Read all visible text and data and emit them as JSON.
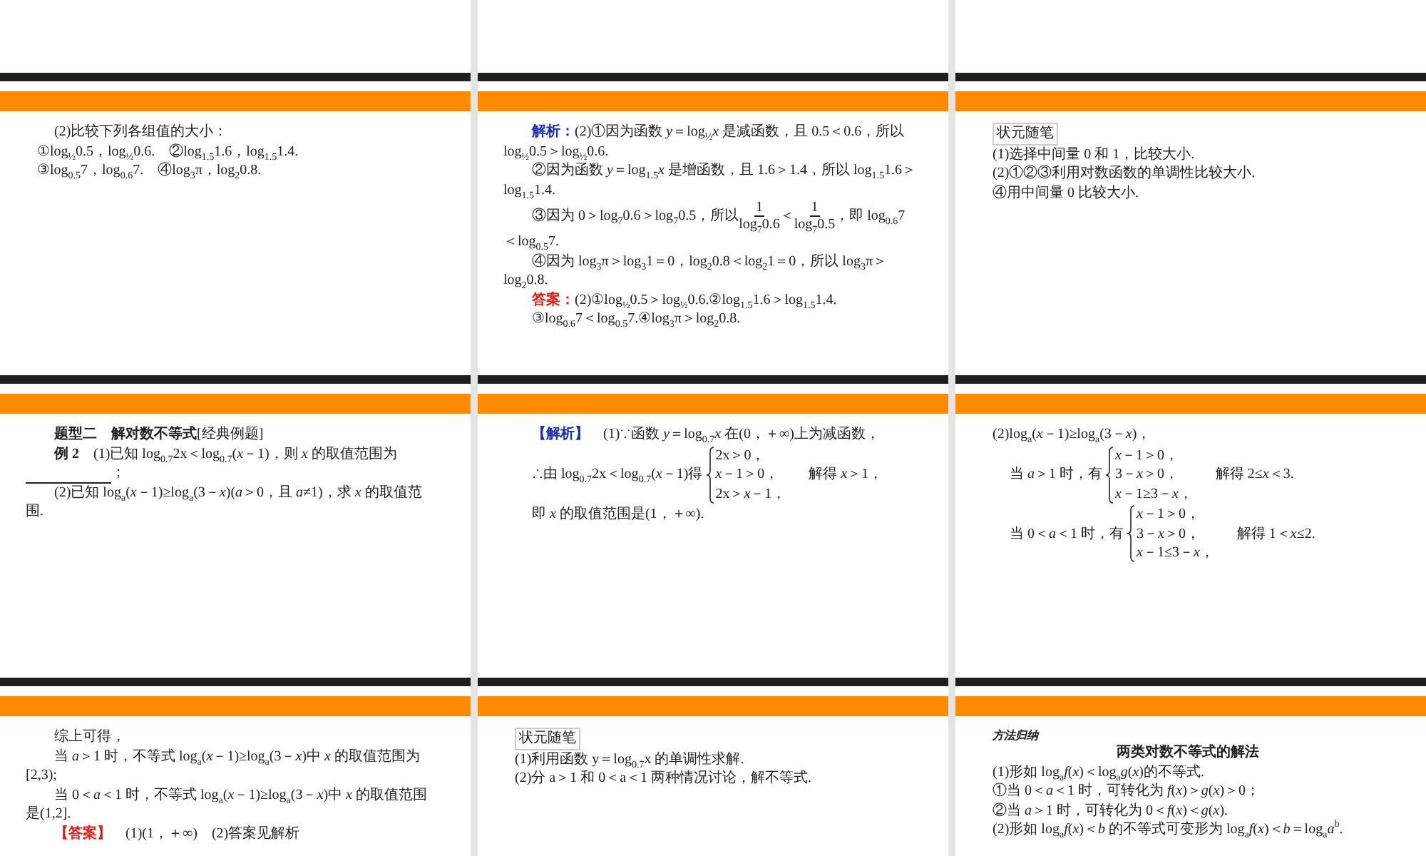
{
  "slides": [
    {
      "blocks": [
        {
          "kind": "para",
          "text": "(2)比较下列各组值的大小："
        },
        {
          "kind": "line",
          "text": "①log$_{½}$0.5，log$_{½}$0.6.　②log$_{1.5}$1.6，log$_{1.5}$1.4."
        },
        {
          "kind": "line",
          "text": "③log$_{0.5}$7，log$_{0.6}$7.　④log$_{3}$π，log$_{2}$0.8."
        }
      ]
    },
    {
      "blocks": [
        {
          "kind": "para",
          "lead": {
            "text": "解析：",
            "kind": "analysis"
          },
          "text": "(2)①因为函数 *y*＝log$_{½}$*x* 是减函数，且 0.5＜0.6，所以 log$_{½}$0.5＞log$_{½}$0.6."
        },
        {
          "kind": "para",
          "text": "②因为函数 *y*＝log$_{1.5}$*x* 是增函数，且 1.6＞1.4，所以 log$_{1.5}$1.6＞log$_{1.5}$1.4."
        },
        {
          "kind": "fraction_para",
          "parts": [
            {
              "text": "③因为 0＞log$_{7}$0.6＞log$_{7}$0.5，所以"
            },
            {
              "num": "1",
              "den": "log$_{7}$0.6"
            },
            {
              "text": "＜"
            },
            {
              "num": "1",
              "den": "log$_{7}$0.5"
            },
            {
              "text": "，即 log$_{0.6}$7＜log$_{0.5}$7."
            }
          ]
        },
        {
          "kind": "para",
          "text": "④因为 log$_{3}$π＞log$_{3}$1＝0，log$_{2}$0.8＜log$_{2}$1＝0，所以 log$_{3}$π＞log$_{2}$0.8."
        },
        {
          "kind": "para",
          "lead": {
            "text": "答案：",
            "kind": "answer"
          },
          "text": "(2)①log$_{½}$0.5＞log$_{½}$0.6.②log$_{1.5}$1.6＞log$_{1.5}$1.4."
        },
        {
          "kind": "para",
          "text": "③log$_{0.6}$7＜log$_{0.5}$7.④log$_{3}$π＞log$_{2}$0.8."
        }
      ]
    },
    {
      "blocks": [
        {
          "kind": "label",
          "text": "状元随笔"
        },
        {
          "kind": "line",
          "text": "(1)选择中间量 0 和 1，比较大小."
        },
        {
          "kind": "line",
          "text": "(2)①②③利用对数函数的单调性比较大小."
        },
        {
          "kind": "line",
          "text": "④用中间量 0 比较大小."
        }
      ]
    },
    {
      "blocks": [
        {
          "kind": "para",
          "text": "**题型二　解对数不等式**[经典例题]"
        },
        {
          "kind": "para",
          "text": "**例 2**　(1)已知 log$_{0.7}$2x＜log$_{0.7}$(*x*－1)，则 *x* 的取值范围为"
        },
        {
          "kind": "blank",
          "text": "；"
        },
        {
          "kind": "para",
          "text": "(2)已知 log$_{a}$(*x*－1)≥log$_{a}$(3－*x*)(*a*＞0，且 *a*≠1)，求 *x* 的取值范围."
        }
      ]
    },
    {
      "blocks": [
        {
          "kind": "para",
          "lead": {
            "text": "【解析】",
            "kind": "analysis"
          },
          "text": "　(1)∵函数 *y*＝log$_{0.7}$*x* 在(0，＋∞)上为减函数，"
        },
        {
          "kind": "system",
          "lead": "∴由 log$_{0.7}$2x＜log$_{0.7}$(*x*－1)得",
          "rows": [
            "2x＞0，",
            "*x*－1＞0，",
            "2x＞*x*－1，"
          ],
          "tail": "解得 *x*＞1，"
        },
        {
          "kind": "para",
          "text": "即 *x* 的取值范围是(1，＋∞)."
        }
      ]
    },
    {
      "blocks": [
        {
          "kind": "line",
          "text": "(2)log$_{a}$(*x*－1)≥log$_{a}$(3－*x*)，"
        },
        {
          "kind": "system",
          "lead": "当 *a*＞1 时，有",
          "rows": [
            "*x*－1＞0，",
            "3－*x*＞0，",
            "*x*－1≥3－*x*，"
          ],
          "tail": "解得 2≤*x*＜3."
        },
        {
          "kind": "system",
          "lead": "当 0＜*a*＜1 时，有",
          "rows": [
            "*x*－1＞0，",
            "3－*x*＞0，",
            "*x*－1≤3－*x*，"
          ],
          "tail": "解得 1＜*x*≤2."
        }
      ]
    },
    {
      "blocks": [
        {
          "kind": "para",
          "text": "综上可得，"
        },
        {
          "kind": "para",
          "text": "当 *a*＞1 时，不等式 log$_{a}$(*x*－1)≥log$_{a}$(3－*x*)中 *x* 的取值范围为[2,3);"
        },
        {
          "kind": "para",
          "text": "当 0＜*a*＜1 时，不等式 log$_{a}$(*x*－1)≥log$_{a}$(3－*x*)中 *x* 的取值范围是(1,2]."
        },
        {
          "kind": "para",
          "lead": {
            "text": "【答案】",
            "kind": "answer"
          },
          "text": "　(1)(1，＋∞)　(2)答案见解析"
        }
      ]
    },
    {
      "blocks": [
        {
          "kind": "label",
          "text": "状元随笔"
        },
        {
          "kind": "line",
          "text": "(1)利用函数 y＝log$_{0.7}$x 的单调性求解."
        },
        {
          "kind": "line",
          "text": "(2)分 a＞1 和 0＜a＜1 两种情况讨论，解不等式."
        }
      ]
    },
    {
      "blocks": [
        {
          "kind": "caption",
          "text": "方法归纳"
        },
        {
          "kind": "title",
          "text": "两类对数不等式的解法"
        },
        {
          "kind": "line",
          "text": "(1)形如 log$_{a}$*f*(*x*)＜log$_{a}$*g*(*x*)的不等式."
        },
        {
          "kind": "line",
          "text": "①当 0＜*a*＜1 时，可转化为 *f*(*x*)＞*g*(*x*)＞0；"
        },
        {
          "kind": "line",
          "text": "②当 *a*＞1 时，可转化为 0＜*f*(*x*)＜*g*(*x*)."
        },
        {
          "kind": "line",
          "text": "(2)形如 log$_{a}$*f*(*x*)＜*b* 的不等式可变形为 log$_{a}$*f*(*x*)＜*b*＝log$_{a}$*a*$^{b}$."
        }
      ]
    }
  ]
}
